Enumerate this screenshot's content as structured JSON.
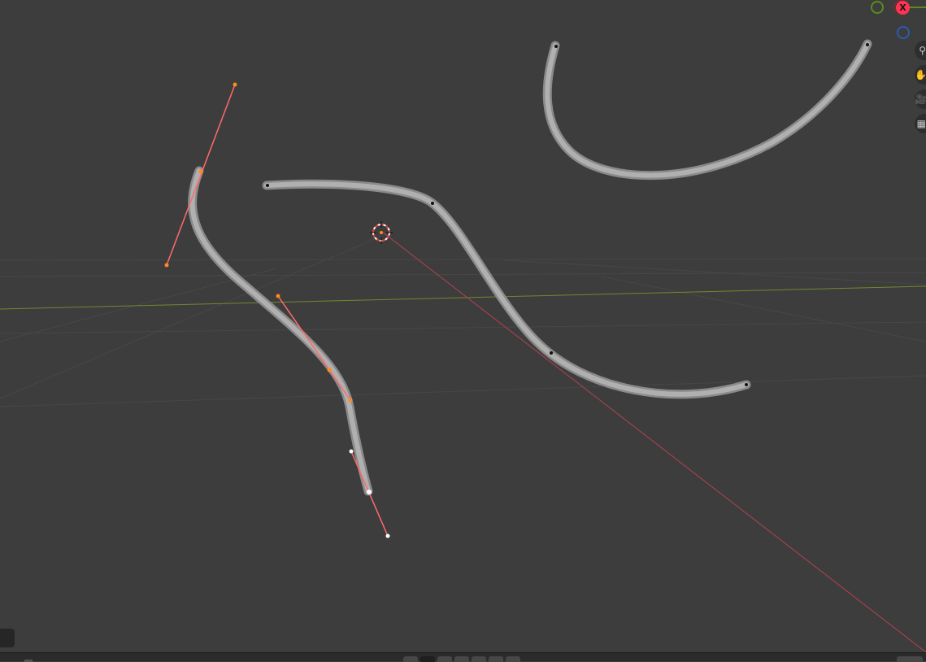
{
  "viewport": {
    "background_color": "#3d3d3d",
    "grid_line_color": "#4a4a4a",
    "x_axis_color": "#b3434f",
    "y_axis_color": "#6e8a2e",
    "curve_color": "#a9a9a9",
    "selected_handle_color": "#ff6b6b",
    "selected_point_color": "#ff8c1a"
  },
  "axis_gizmo": {
    "x_label": "X",
    "x_color": "#ff3352",
    "y_color": "#8bc34a",
    "z_color": "#3a72d6"
  },
  "nav_tools": [
    {
      "icon": "zoom-icon",
      "glyph": "⚲"
    },
    {
      "icon": "hand-pan-icon",
      "glyph": "✋"
    },
    {
      "icon": "camera-icon",
      "glyph": "🎥"
    },
    {
      "icon": "grid-view-icon",
      "glyph": "▦"
    }
  ],
  "scene": {
    "cursor_3d": "3d-cursor-icon"
  }
}
